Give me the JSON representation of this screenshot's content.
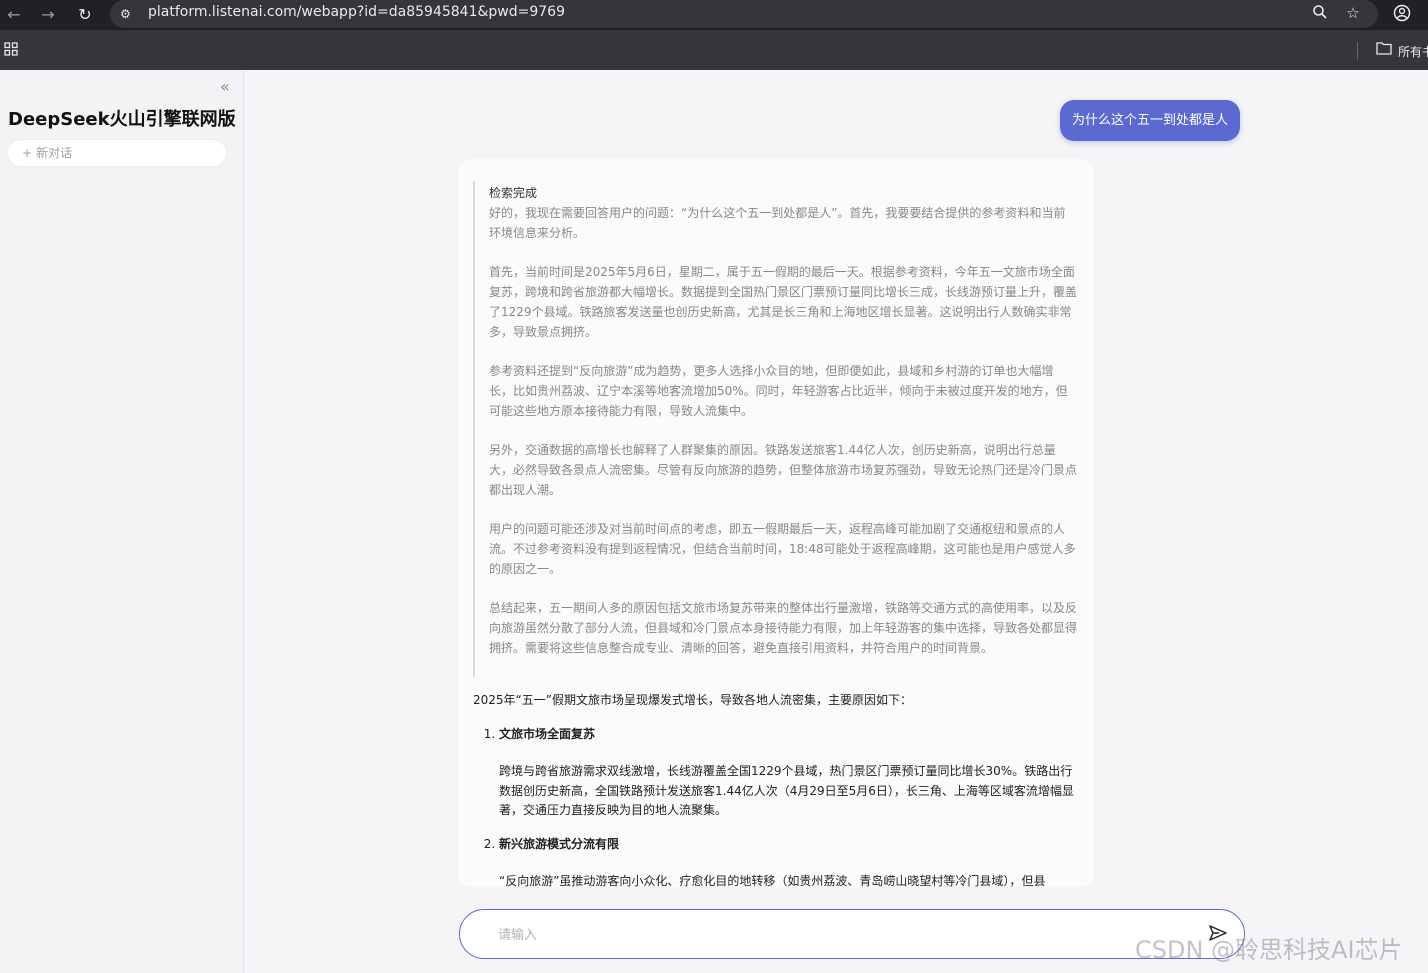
{
  "browser": {
    "url": "platform.listenai.com/webapp?id=da85945841&pwd=9769",
    "bookmarks_folder_label": "所有书"
  },
  "sidebar": {
    "title": "DeepSeek火山引擎联网版",
    "new_chat_label": "新对话"
  },
  "chat": {
    "user_message": "为什么这个五一到处都是人",
    "thinking": {
      "title": "检索完成",
      "paragraphs": [
        "好的，我现在需要回答用户的问题：“为什么这个五一到处都是人”。首先，我要要结合提供的参考资料和当前环境信息来分析。",
        "首先，当前时间是2025年5月6日，星期二，属于五一假期的最后一天。根据参考资料，今年五一文旅市场全面复苏，跨境和跨省旅游都大幅增长。数据提到全国热门景区门票预订量同比增长三成，长线游预订量上升，覆盖了1229个县域。铁路旅客发送量也创历史新高，尤其是长三角和上海地区增长显著。这说明出行人数确实非常多，导致景点拥挤。",
        "参考资料还提到“反向旅游”成为趋势，更多人选择小众目的地，但即便如此，县域和乡村游的订单也大幅增长，比如贵州荔波、辽宁本溪等地客流增加50%。同时，年轻游客占比近半，倾向于未被过度开发的地方，但可能这些地方原本接待能力有限，导致人流集中。",
        "另外，交通数据的高增长也解释了人群聚集的原因。铁路发送旅客1.44亿人次，创历史新高，说明出行总量大，必然导致各景点人流密集。尽管有反向旅游的趋势，但整体旅游市场复苏强劲，导致无论热门还是冷门景点都出现人潮。",
        "用户的问题可能还涉及对当前时间点的考虑，即五一假期最后一天，返程高峰可能加剧了交通枢纽和景点的人流。不过参考资料没有提到返程情况，但结合当前时间，18:48可能处于返程高峰期，这可能也是用户感觉人多的原因之一。",
        "总结起来，五一期间人多的原因包括文旅市场复苏带来的整体出行量激增，铁路等交通方式的高使用率，以及反向旅游虽然分散了部分人流，但县域和冷门景点本身接待能力有限，加上年轻游客的集中选择，导致各处都显得拥挤。需要将这些信息整合成专业、清晰的回答，避免直接引用资料，并符合用户的时间背景。"
      ]
    },
    "answer": {
      "intro": "2025年“五一”假期文旅市场呈现爆发式增长，导致各地人流密集，主要原因如下：",
      "points": [
        {
          "heading": "文旅市场全面复苏",
          "body": "跨境与跨省旅游需求双线激增，长线游覆盖全国1229个县域，热门景区门票预订量同比增长30%。铁路出行数据创历史新高，全国铁路预计发送旅客1.44亿人次（4月29日至5月6日），长三角、上海等区域客流增幅显著，交通压力直接反映为目的地人流聚集。"
        },
        {
          "heading": "新兴旅游模式分流有限",
          "body": "“反向旅游”虽推动游客向小众化、疗愈化目的地转移（如贵州荔波、青岛崂山晓望村等冷门县域），但县"
        }
      ]
    },
    "input_placeholder": "请输入",
    "input_value": ""
  },
  "watermark": "CSDN @聆思科技AI芯片"
}
